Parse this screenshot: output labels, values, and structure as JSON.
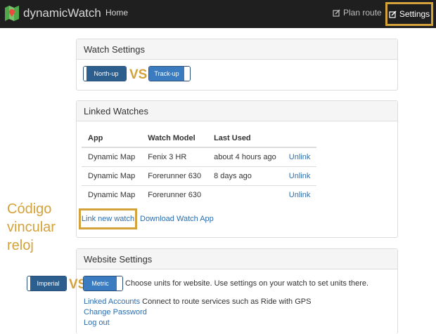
{
  "navbar": {
    "brand": "dynamicWatch",
    "home": "Home",
    "plan_route": "Plan route",
    "settings": "Settings"
  },
  "watch_settings": {
    "title": "Watch Settings",
    "north_up": "North-up",
    "vs": "VS",
    "track_up": "Track-up"
  },
  "linked_watches": {
    "title": "Linked Watches",
    "columns": [
      "App",
      "Watch Model",
      "Last Used",
      ""
    ],
    "rows": [
      {
        "app": "Dynamic Map",
        "model": "Fenix 3 HR",
        "last_used": "about 4 hours ago",
        "action": "Unlink"
      },
      {
        "app": "Dynamic Map",
        "model": "Forerunner 630",
        "last_used": "8 days ago",
        "action": "Unlink"
      },
      {
        "app": "Dynamic Map",
        "model": "Forerunner 630",
        "last_used": "",
        "action": "Unlink"
      }
    ],
    "link_new": "Link new watch",
    "download_app": "Download Watch App"
  },
  "annotation": "Código vincular reloj",
  "website_settings": {
    "title": "Website Settings",
    "imperial": "Imperial",
    "vs": "VS",
    "metric": "Metric",
    "units_text": "Choose units for website. Use settings on your watch to set units there.",
    "linked_accounts": "Linked Accounts",
    "linked_accounts_text": " Connect to route services such as Ride with GPS",
    "change_password": "Change Password",
    "log_out": "Log out"
  },
  "colors": {
    "accent": "#d4a23a",
    "navbar": "#1f1f1f",
    "toggle_dark": "#2c5e8e",
    "toggle_light": "#3b7bbf",
    "link": "#2a6db0"
  }
}
